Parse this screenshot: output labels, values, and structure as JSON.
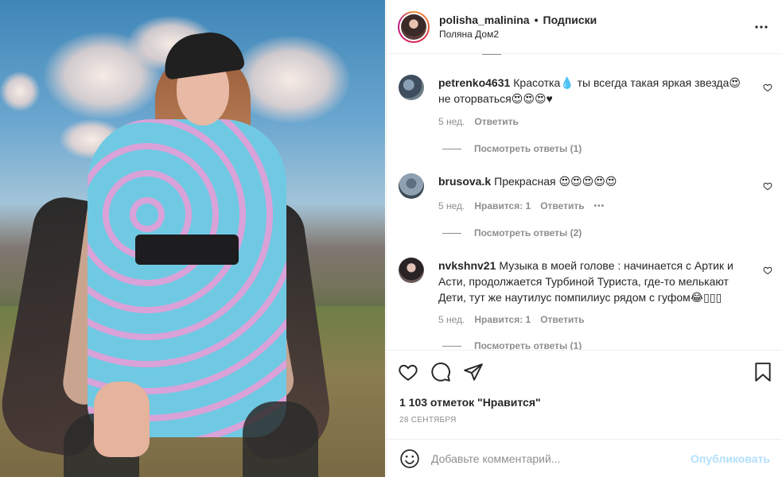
{
  "header": {
    "username": "polisha_malinina",
    "separator": "•",
    "follow_label": "Подписки",
    "location": "Поляна Дом2",
    "more_icon": "more-horizontal-icon"
  },
  "comments": [
    {
      "username": "petrenko4631",
      "text": "Красотка💧 ты всегда такая яркая звезда😍 не оторваться😍😍😍♥",
      "time": "5 нед.",
      "reply_label": "Ответить",
      "view_replies": "Посмотреть ответы (1)"
    },
    {
      "username": "brusova.k",
      "text": "Прекрасная 😍😍😍😍😍",
      "time": "5 нед.",
      "likes": "Нравится: 1",
      "reply_label": "Ответить",
      "more": "•••",
      "view_replies": "Посмотреть ответы (2)"
    },
    {
      "username": "nvkshnv21",
      "text": "Музыка в моей голове : начинается с Артик и Асти, продолжается Турбиной Туриста, где-то мелькают Дети, тут же наутилус помпилиус рядом с гуфом😂▯▯▯",
      "time": "5 нед.",
      "likes": "Нравится: 1",
      "reply_label": "Ответить",
      "view_replies": "Посмотреть ответы (1)"
    }
  ],
  "actions": {
    "likes": "1 103 отметок \"Нравится\"",
    "date": "28 СЕНТЯБРЯ"
  },
  "add_comment": {
    "placeholder": "Добавьте комментарий...",
    "publish_label": "Опубликовать"
  },
  "colors": {
    "publish_disabled": "#b2dffc",
    "muted_text": "#8e8e8e",
    "primary_text": "#262626"
  }
}
